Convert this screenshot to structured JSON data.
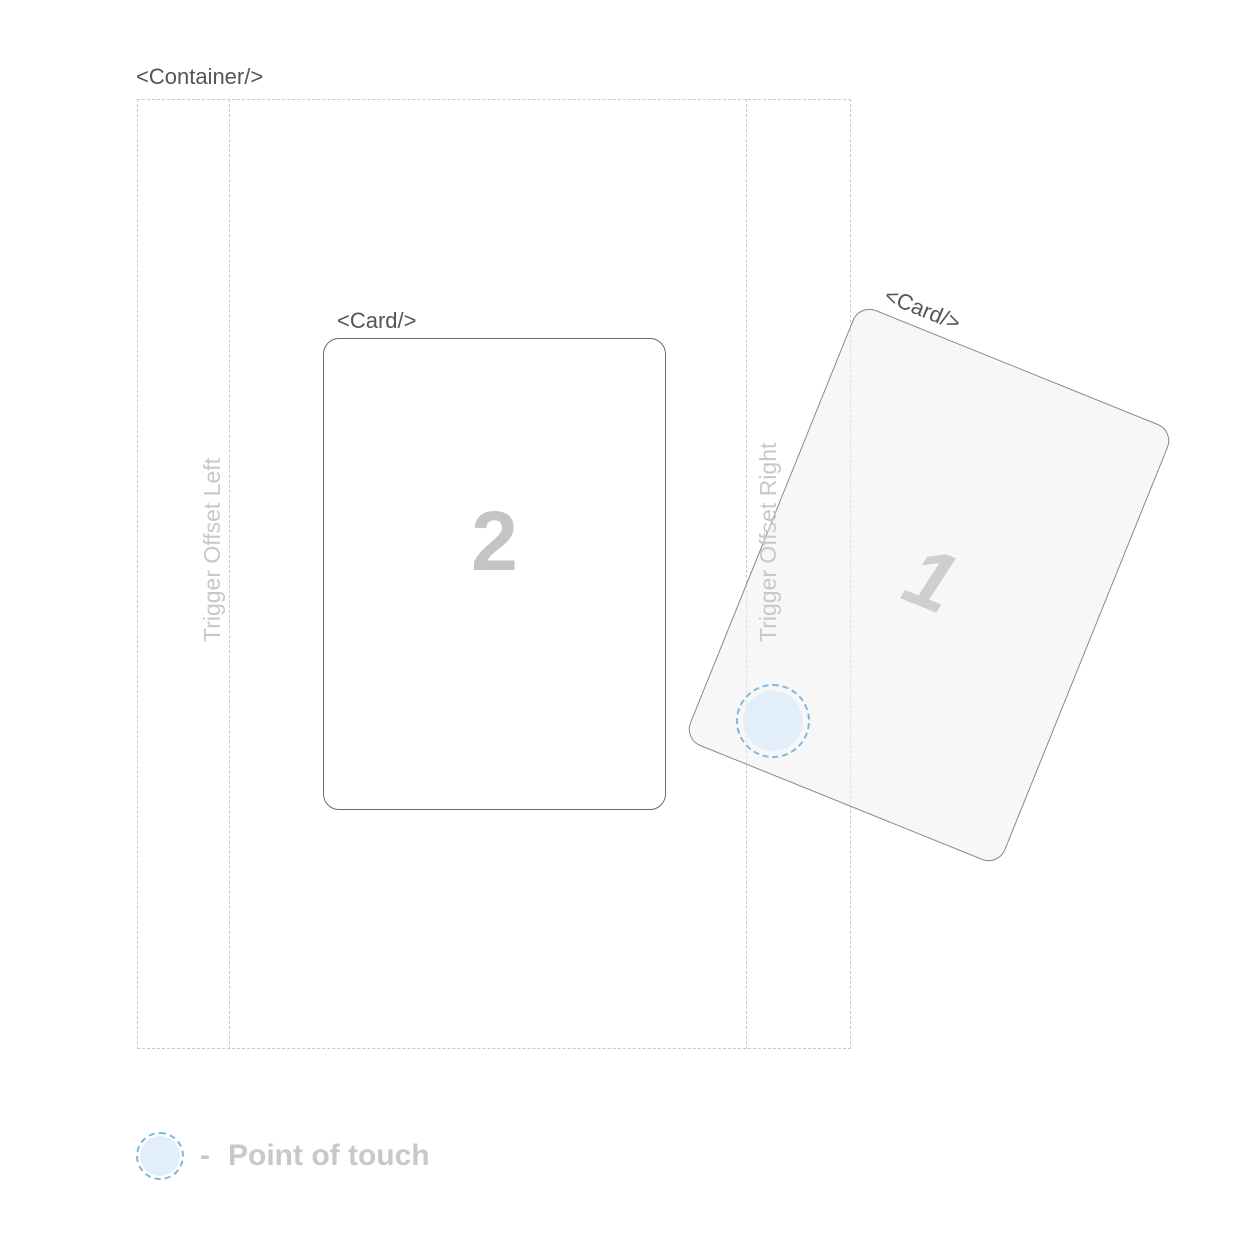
{
  "container": {
    "label": "<Container/>",
    "trigger_offset_left_label": "Trigger Offset Left",
    "trigger_offset_right_label": "Trigger Offset Right"
  },
  "cards": {
    "card2": {
      "label": "<Card/>",
      "number": "2"
    },
    "card1": {
      "label": "<Card/>",
      "number": "1"
    }
  },
  "legend": {
    "separator": "-",
    "text": "Point of touch"
  },
  "colors": {
    "dashed_line": "#c9c9c9",
    "card_border": "#6a6a6a",
    "touch_fill": "#e2eef9",
    "touch_border": "#7cb9e0",
    "muted_text": "#c8c8c8",
    "label_text": "#555555"
  },
  "icons": {
    "touch_point": "touch-point-icon"
  }
}
